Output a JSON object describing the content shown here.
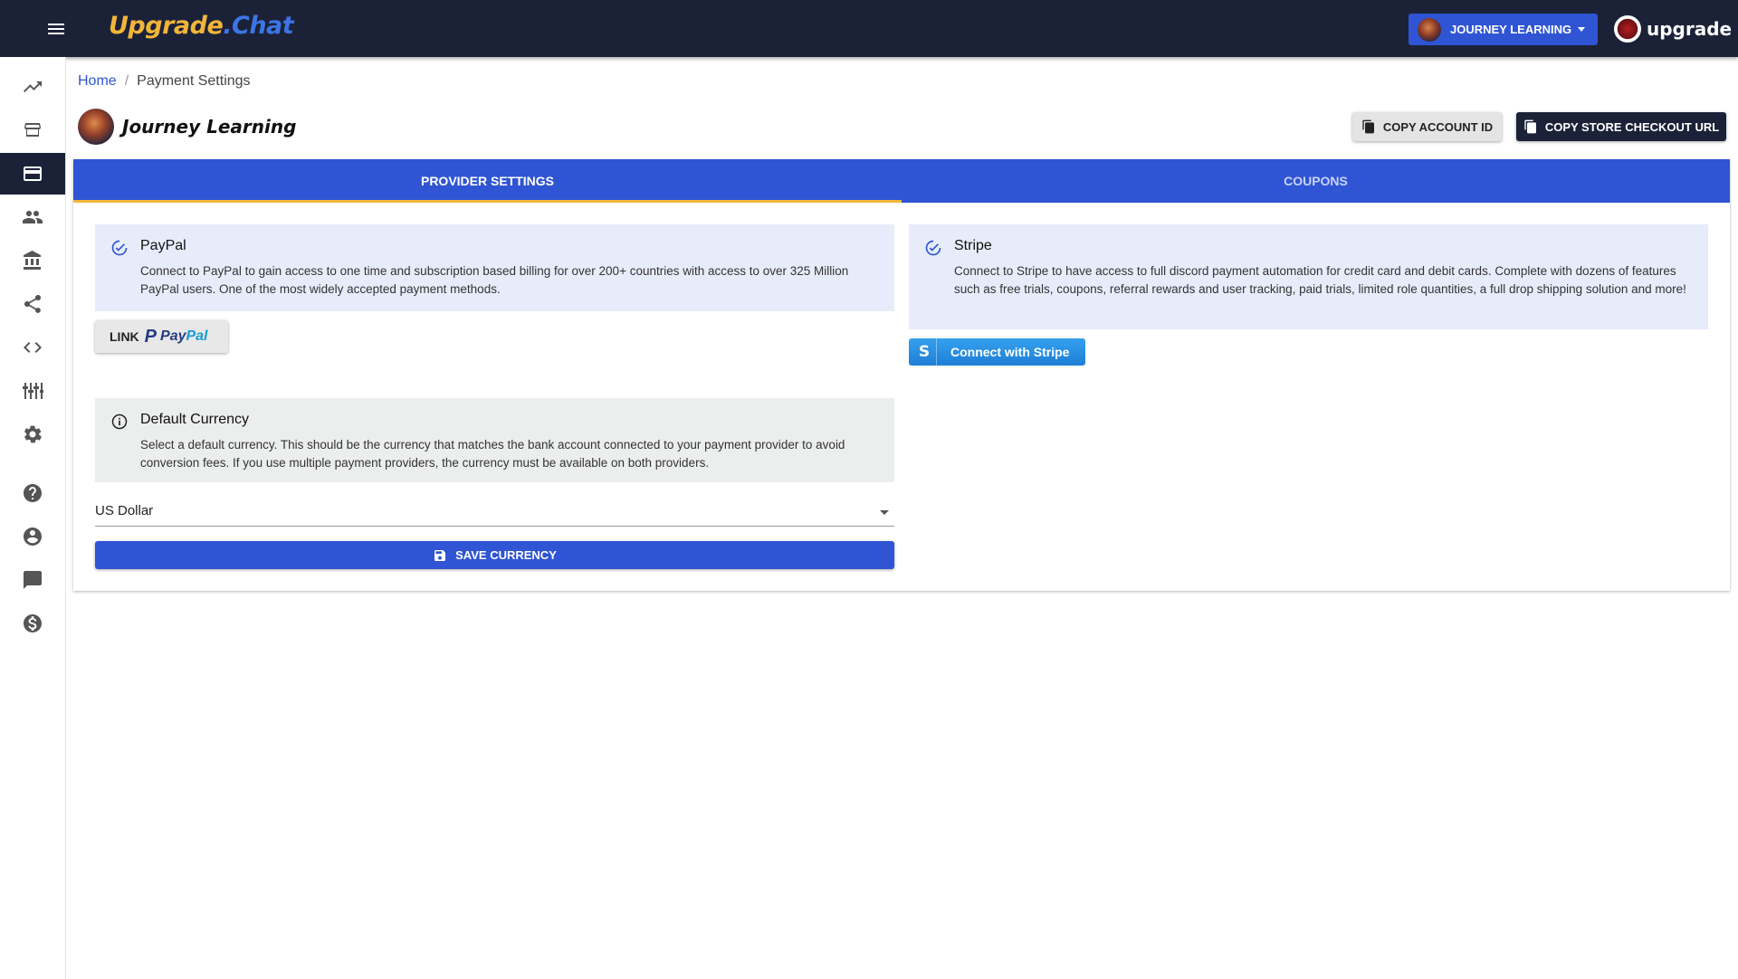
{
  "brand": {
    "part1": "Upgrade",
    "part2": ".Chat"
  },
  "header": {
    "account_selector": "JOURNEY LEARNING",
    "user_name": "upgrade"
  },
  "sidebar": {
    "items": [
      {
        "icon": "trending-up-icon"
      },
      {
        "icon": "storefront-icon"
      },
      {
        "icon": "credit-card-icon",
        "active": true
      },
      {
        "icon": "people-icon"
      },
      {
        "icon": "bank-icon"
      },
      {
        "icon": "share-icon"
      },
      {
        "icon": "code-icon"
      },
      {
        "icon": "sliders-icon"
      },
      {
        "icon": "gear-icon"
      },
      {
        "icon": "help-icon"
      },
      {
        "icon": "account-circle-icon"
      },
      {
        "icon": "chat-icon"
      },
      {
        "icon": "dollar-icon"
      }
    ]
  },
  "breadcrumb": {
    "home": "Home",
    "separator": "/",
    "current": "Payment Settings"
  },
  "store": {
    "name": "Journey Learning"
  },
  "actions": {
    "copy_account_id": "COPY ACCOUNT ID",
    "copy_checkout_url": "COPY STORE CHECKOUT URL"
  },
  "tabs": [
    {
      "label": "PROVIDER SETTINGS",
      "active": true
    },
    {
      "label": "COUPONS",
      "active": false
    }
  ],
  "paypal": {
    "title": "PayPal",
    "description": "Connect to PayPal to gain access to one time and subscription based billing for over 200+ countries with access to over 325 Million PayPal users. One of the most widely accepted payment methods.",
    "button_prefix": "LINK",
    "brand_part1": "Pay",
    "brand_part2": "Pal"
  },
  "stripe": {
    "title": "Stripe",
    "description": "Connect to Stripe to have access to full discord payment automation for credit card and debit cards. Complete with dozens of features such as free trials, coupons, referral rewards and user tracking, paid trials, limited role quantities, a full drop shipping solution and more!",
    "button_label": "Connect with Stripe",
    "button_mark": "S"
  },
  "currency": {
    "title": "Default Currency",
    "description": "Select a default currency. This should be the currency that matches the bank account connected to your payment provider to avoid conversion fees. If you use multiple payment providers, the currency must be available on both providers.",
    "selected": "US Dollar",
    "save_label": "SAVE CURRENCY"
  },
  "colors": {
    "topbar": "#1b2238",
    "primary": "#2f55d4",
    "accent": "#f2b53a",
    "info_bg": "#e7ecfb"
  }
}
